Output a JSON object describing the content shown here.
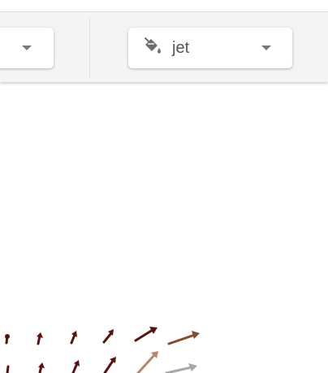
{
  "toolbar": {
    "colormap_select": {
      "value": "jet",
      "icon": "paint-bucket-icon"
    },
    "left_select": {
      "value": ""
    }
  },
  "colors": {
    "toolbar_bg": "#f4f4f4",
    "select_bg": "#ffffff",
    "caret": "#7a7a7a",
    "icon": "#6e6e6e",
    "value_text": "#555555",
    "arrow_dark": "#5a120e",
    "arrow_brown": "#8a4a2a",
    "arrow_tan": "#b4876c",
    "arrow_gray": "#a8a8a8"
  }
}
